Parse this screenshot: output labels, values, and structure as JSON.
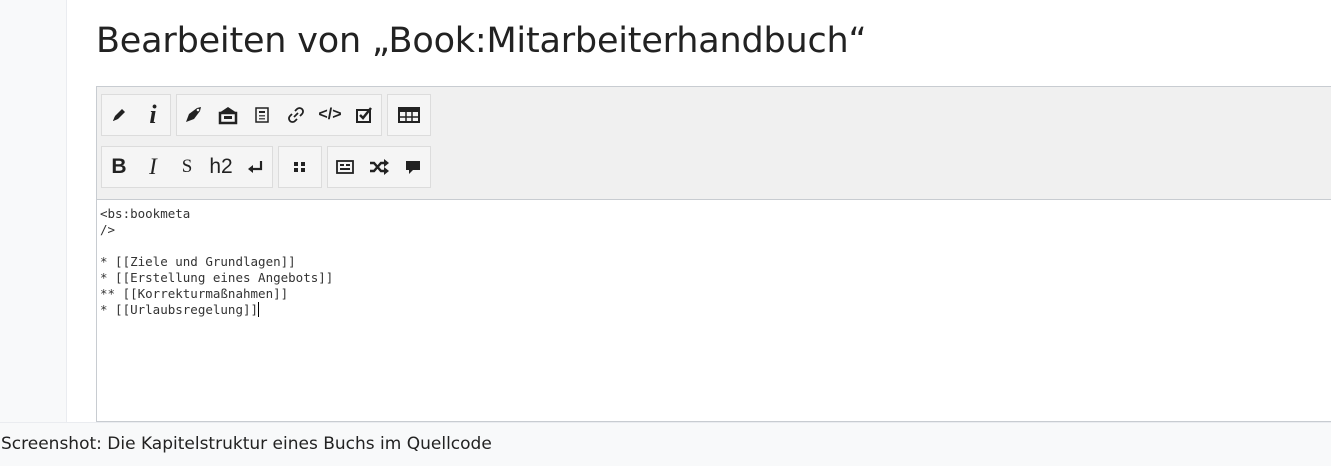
{
  "page": {
    "title": "Bearbeiten von „Book:Mitarbeiterhandbuch“"
  },
  "toolbar": {
    "row1": [
      {
        "name": "edit-pencil-icon"
      },
      {
        "name": "info-icon",
        "label": "i"
      },
      {
        "name": "tag-icon"
      },
      {
        "name": "box-icon"
      },
      {
        "name": "document-icon"
      },
      {
        "name": "link-icon"
      },
      {
        "name": "code-icon",
        "label": "</>"
      },
      {
        "name": "checkbox-icon"
      },
      {
        "name": "table-icon"
      }
    ],
    "row2": [
      {
        "name": "bold-button",
        "label": "B"
      },
      {
        "name": "italic-button",
        "label": "I"
      },
      {
        "name": "strikethrough-button",
        "label": "S"
      },
      {
        "name": "heading-button",
        "label": "h2"
      },
      {
        "name": "linebreak-icon"
      },
      {
        "name": "list-icon"
      },
      {
        "name": "template-icon"
      },
      {
        "name": "shuffle-icon"
      },
      {
        "name": "comment-icon"
      }
    ]
  },
  "editor": {
    "lines": [
      "<bs:bookmeta",
      "/>",
      "",
      "* [[Ziele und Grundlagen]]",
      "* [[Erstellung eines Angebots]]",
      "** [[Korrekturmaßnahmen]]",
      "* [[Urlaubsregelung]]"
    ]
  },
  "caption": "Screenshot: Die Kapitelstruktur eines Buchs im Quellcode"
}
